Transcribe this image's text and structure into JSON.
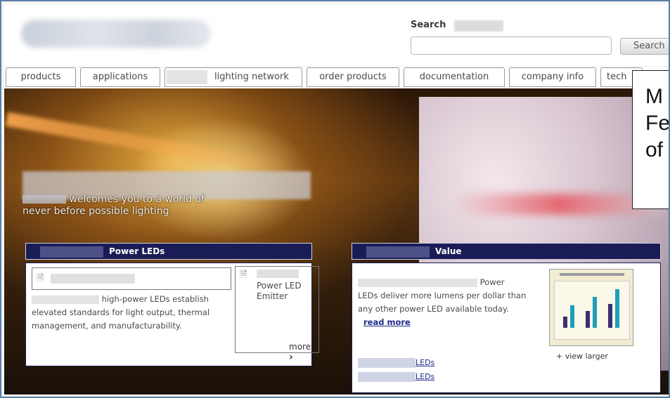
{
  "search": {
    "label": "Search",
    "button": "Search",
    "value": ""
  },
  "nav": {
    "tabs": [
      {
        "label": "products"
      },
      {
        "label": "applications"
      },
      {
        "label": "lighting network"
      },
      {
        "label": "order products"
      },
      {
        "label": "documentation"
      },
      {
        "label": "company info"
      },
      {
        "label": "tech"
      }
    ]
  },
  "hero": {
    "welcome_line1": "welcomes you to a world of",
    "welcome_line2": "never before possible lighting"
  },
  "callout": {
    "line1": "M",
    "line2": "Fe",
    "line3": "of"
  },
  "power_leds": {
    "title": "Power LEDs",
    "text_part1": "high-power LEDs establish",
    "text_part2": "elevated standards for light output, thermal management, and manufacturability.",
    "emitter_label": "Power LED Emitter",
    "more_label": "more",
    "more_arrow": "›"
  },
  "value": {
    "title": "Value",
    "text_part1": "Power",
    "text_part2": "LEDs deliver more lumens per dollar than any other power LED available today.",
    "read_more": "read more",
    "link1": "LEDs",
    "link2": "LEDs",
    "view_larger": "+ view larger",
    "thumbnail_bars": [
      {
        "value": 0.28,
        "color": "#3b2f6e"
      },
      {
        "value": 0.55,
        "color": "#1aa0b8"
      },
      {
        "value": 0.42,
        "color": "#3b2f6e"
      },
      {
        "value": 0.75,
        "color": "#1aa0b8"
      },
      {
        "value": 0.58,
        "color": "#3b2f6e"
      },
      {
        "value": 0.95,
        "color": "#1aa0b8"
      }
    ]
  },
  "colors": {
    "nav_border": "#9a9a9a",
    "panel_header": "#1a1d55",
    "link": "#1f2a8a"
  }
}
